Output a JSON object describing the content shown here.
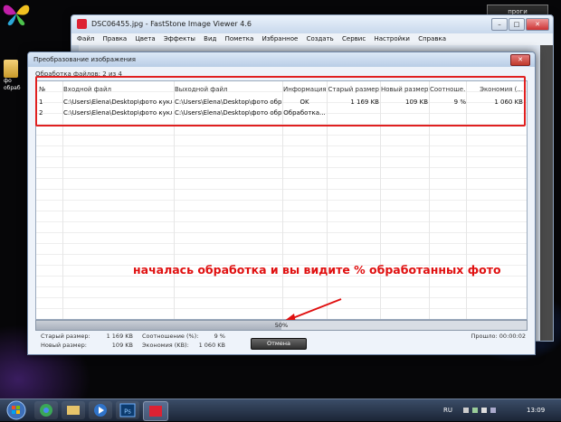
{
  "desktop": {
    "progi_label": "проги",
    "folder_label_line1": "фо",
    "folder_label_line2": "обраб"
  },
  "app_window": {
    "title": "DSC06455.jpg  -  FastStone Image Viewer 4.6",
    "menu": [
      "Файл",
      "Правка",
      "Цвета",
      "Эффекты",
      "Вид",
      "Пометка",
      "Избранное",
      "Создать",
      "Сервис",
      "Настройки",
      "Справка"
    ],
    "minimize_symbol": "–",
    "maximize_symbol": "□",
    "close_symbol": "✕"
  },
  "dialog": {
    "title": "Преобразование изображения",
    "close_symbol": "✕",
    "processed_text": "Обработка файлов: 2 из 4",
    "columns": {
      "num": "№",
      "input": "Входной файл",
      "output": "Выходной файл",
      "info": "Информация",
      "old_size": "Старый размер",
      "new_size": "Новый размер",
      "ratio": "Соотноше...",
      "savings": "Экономия (..."
    },
    "rows": [
      {
        "num": "1",
        "input": "C:\\Users\\Elena\\Desktop\\фото кукл...",
        "output": "C:\\Users\\Elena\\Desktop\\фото обраб...",
        "info": "OK",
        "old_size": "1 169 KB",
        "new_size": "109 KB",
        "ratio": "9 %",
        "savings": "1 060 KB"
      },
      {
        "num": "2",
        "input": "C:\\Users\\Elena\\Desktop\\фото кукл...",
        "output": "C:\\Users\\Elena\\Desktop\\фото обраб...",
        "info": "Обработка...",
        "old_size": "",
        "new_size": "",
        "ratio": "",
        "savings": ""
      }
    ],
    "annotation": "началась обработка и вы видите % обработанных фото",
    "progress": {
      "value": 0.5,
      "label": "50%"
    },
    "stats": {
      "old_size_label": "Старый размер:",
      "old_size_value": "1 169 KB",
      "new_size_label": "Новый размер:",
      "new_size_value": "109 KB",
      "ratio_label": "Соотношение (%):",
      "ratio_value": "9 %",
      "savings_label": "Экономия (KB):",
      "savings_value": "1 060 KB"
    },
    "cancel_label": "Отмена",
    "elapsed_text": "Прошло: 00:00:02"
  },
  "taskbar": {
    "lang": "RU",
    "clock": "13:09",
    "apps": [
      "chrome-icon",
      "explorer-icon",
      "media-player-icon",
      "photoshop-icon",
      "faststone-icon"
    ],
    "ps_label": "Ps"
  },
  "colors": {
    "annotation": "#e01010",
    "highlight_border": "#e02020",
    "taskbar": "#1b2536"
  }
}
